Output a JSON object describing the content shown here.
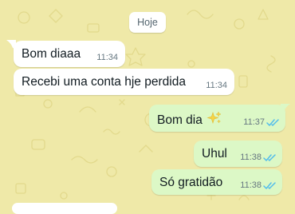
{
  "date_chip": "Hoje",
  "messages": [
    {
      "direction": "incoming",
      "text": "Bom diaaa",
      "time": "11:34"
    },
    {
      "direction": "incoming",
      "text": "Recebi uma conta hje perdida",
      "time": "11:34"
    },
    {
      "direction": "outgoing",
      "text": "Bom dia",
      "time": "11:37",
      "emoji": "sparkles-icon",
      "status": "read"
    },
    {
      "direction": "outgoing",
      "text": "Uhul",
      "time": "11:38",
      "status": "read"
    },
    {
      "direction": "outgoing",
      "text": "Só gratidão",
      "time": "11:38",
      "status": "read"
    }
  ],
  "colors": {
    "wallpaper": "#efe9a8",
    "incoming_bubble": "#ffffff",
    "outgoing_bubble": "#dcf8c6",
    "read_ticks": "#53bdeb",
    "sparkles": "#f5d547"
  }
}
